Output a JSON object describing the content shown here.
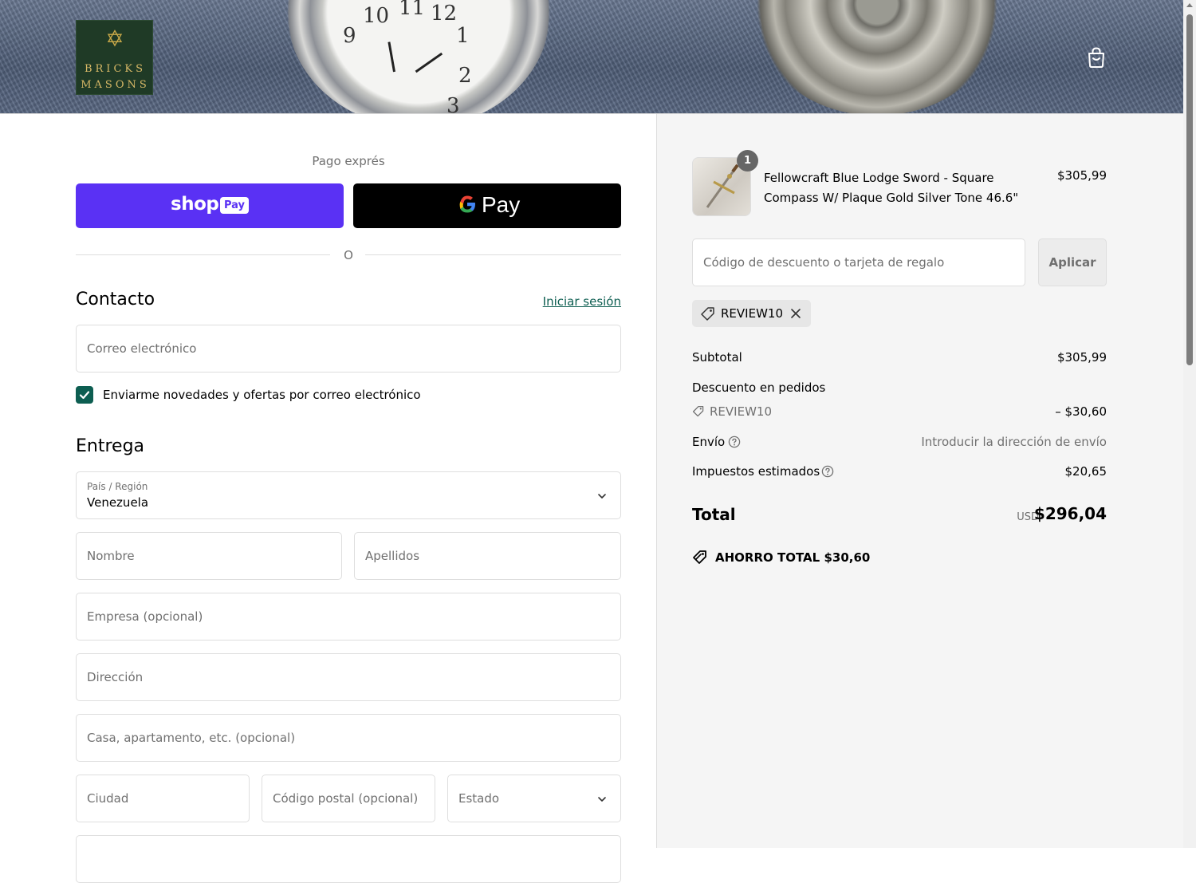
{
  "brand": {
    "logo_line1": "BRICKS",
    "logo_line2": "MASONS"
  },
  "express": {
    "label": "Pago exprés",
    "shop_pay": {
      "word": "shop",
      "badge": "Pay"
    },
    "google_pay": {
      "g": "G",
      "word": "Pay"
    },
    "divider": "O"
  },
  "contact": {
    "title": "Contacto",
    "login_link": "Iniciar sesión",
    "email_placeholder": "Correo electrónico",
    "newsletter_label": "Enviarme novedades y ofertas por correo electrónico",
    "newsletter_checked": true
  },
  "delivery": {
    "title": "Entrega",
    "country_label": "País / Región",
    "country_value": "Venezuela",
    "first_name_placeholder": "Nombre",
    "last_name_placeholder": "Apellidos",
    "company_placeholder": "Empresa (opcional)",
    "address_placeholder": "Dirección",
    "apartment_placeholder": "Casa, apartamento, etc. (opcional)",
    "city_placeholder": "Ciudad",
    "postal_placeholder": "Código postal (opcional)",
    "state_placeholder": "Estado"
  },
  "summary": {
    "product": {
      "quantity": "1",
      "name": "Fellowcraft Blue Lodge Sword - Square Compass W/ Plaque Gold Silver Tone 46.6\"",
      "price": "$305,99"
    },
    "discount_placeholder": "Código de descuento o tarjeta de regalo",
    "apply_label": "Aplicar",
    "applied_code": "REVIEW10",
    "subtotal_label": "Subtotal",
    "subtotal_value": "$305,99",
    "order_discount_label": "Descuento en pedidos",
    "order_discount_code": "REVIEW10",
    "order_discount_value": "– $30,60",
    "shipping_label": "Envío",
    "shipping_value": "Introducir la dirección de envío",
    "taxes_label": "Impuestos estimados",
    "taxes_value": "$20,65",
    "total_label": "Total",
    "total_currency": "USD",
    "total_value": "$296,04",
    "savings_label": "AHORRO TOTAL",
    "savings_value": "$30,60"
  },
  "colors": {
    "accent": "#0d5e51",
    "shop_pay": "#5a31f4",
    "google_pay": "#000000",
    "summary_bg": "#f5f5f5"
  },
  "icons": [
    "cart-icon",
    "chevron-down-icon",
    "tag-icon",
    "close-icon",
    "help-icon",
    "checkmark-icon",
    "savings-tag-icon"
  ]
}
